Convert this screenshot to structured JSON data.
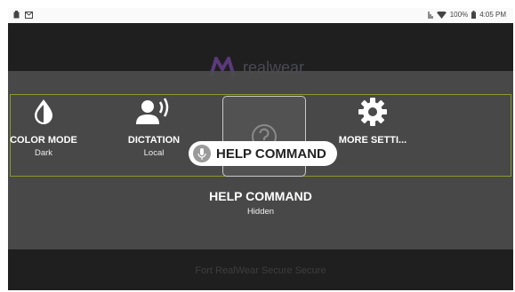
{
  "status_bar": {
    "left_icons": [
      "battery-icon",
      "mail-icon"
    ],
    "right_icons": [
      "signal-icon",
      "wifi-icon",
      "battery-icon"
    ],
    "battery": "100%",
    "time": "4:05 PM"
  },
  "background": {
    "logo_text": "realwear",
    "footer": "Fort RealWear Secure Secure"
  },
  "menu": {
    "items": [
      {
        "label": "COLOR MODE",
        "sub": "Dark",
        "icon": "contrast-icon"
      },
      {
        "label": "DICTATION",
        "sub": "Local",
        "icon": "speaking-user-icon"
      },
      {
        "label": "HELP COMMAND",
        "sub": "Hidden",
        "icon": "help-icon"
      },
      {
        "label": "MORE SETTI...",
        "sub": "",
        "icon": "gear-icon"
      }
    ],
    "selected_title": "HELP COMMAND",
    "selected_sub": "Hidden"
  },
  "voice_command": {
    "text": "HELP COMMAND",
    "icon": "microphone-icon"
  },
  "colors": {
    "accent_border": "#8a9a2f",
    "overlay": "#4b4b4b",
    "pill": "#ffffff"
  }
}
